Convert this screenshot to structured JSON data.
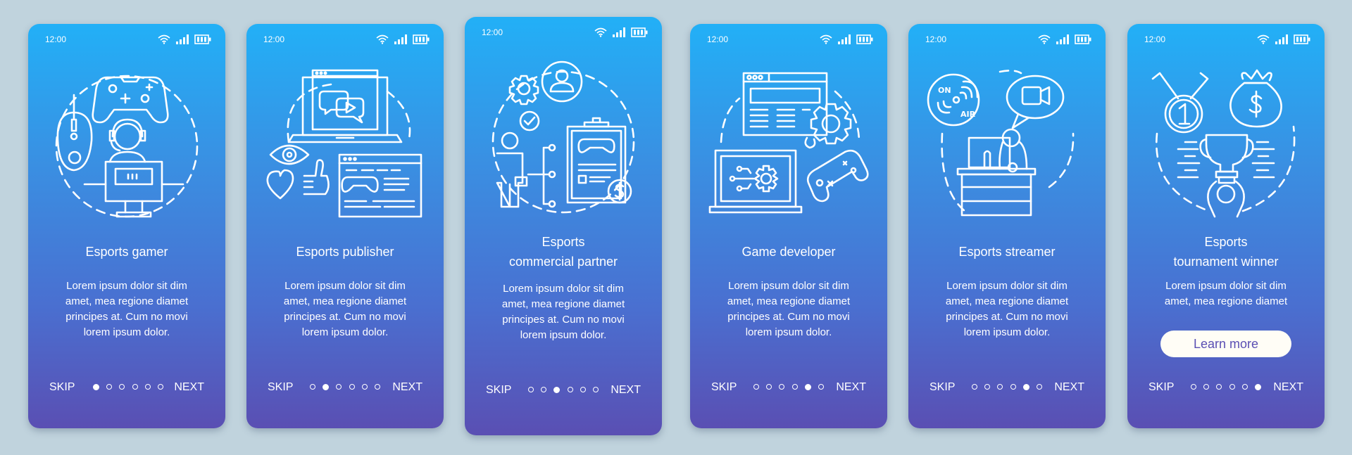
{
  "colors": {
    "background": "#c0d3dd",
    "gradient_top": "#22b0f7",
    "gradient_bottom": "#5a4fb3",
    "button_bg": "#fffdf6",
    "button_text": "#5a4fb3"
  },
  "status_bar": {
    "time": "12:00",
    "icons": [
      "wifi-icon",
      "signal-icon",
      "battery-icon"
    ]
  },
  "screens": [
    {
      "illustration": "esports-gamer-illustration",
      "title": "Esports gamer",
      "body": "Lorem ipsum dolor sit dim\namet, mea regione diamet\nprincipes at. Cum no movi\nlorem ipsum dolor.",
      "skip": "SKIP",
      "next": "NEXT",
      "active_page": 1,
      "total_pages": 6
    },
    {
      "illustration": "esports-publisher-illustration",
      "title": "Esports publisher",
      "body": "Lorem ipsum dolor sit dim\namet, mea regione diamet\nprincipes at. Cum no movi\nlorem ipsum dolor.",
      "skip": "SKIP",
      "next": "NEXT",
      "active_page": 2,
      "total_pages": 6
    },
    {
      "illustration": "commercial-partner-illustration",
      "title_line1": "Esports",
      "title_line2": "commercial partner",
      "body": "Lorem ipsum dolor sit dim\namet, mea regione diamet\nprincipes at. Cum no movi\nlorem ipsum dolor.",
      "skip": "SKIP",
      "next": "NEXT",
      "active_page": 3,
      "total_pages": 6
    },
    {
      "illustration": "game-developer-illustration",
      "title": "Game developer",
      "body": "Lorem ipsum dolor sit dim\namet, mea regione diamet\nprincipes at. Cum no movi\nlorem ipsum dolor.",
      "skip": "SKIP",
      "next": "NEXT",
      "active_page": 5,
      "total_pages": 6
    },
    {
      "illustration": "esports-streamer-illustration",
      "title": "Esports streamer",
      "body": "Lorem ipsum dolor sit dim\namet, mea regione diamet\nprincipes at. Cum no movi\nlorem ipsum dolor.",
      "skip": "SKIP",
      "next": "NEXT",
      "active_page": 5,
      "total_pages": 6
    },
    {
      "illustration": "tournament-winner-illustration",
      "title_line1": "Esports",
      "title_line2": "tournament winner",
      "body": "Lorem ipsum dolor sit dim\namet, mea regione diamet",
      "button": "Learn more",
      "skip": "SKIP",
      "next": "NEXT",
      "active_page": 6,
      "total_pages": 6
    }
  ]
}
